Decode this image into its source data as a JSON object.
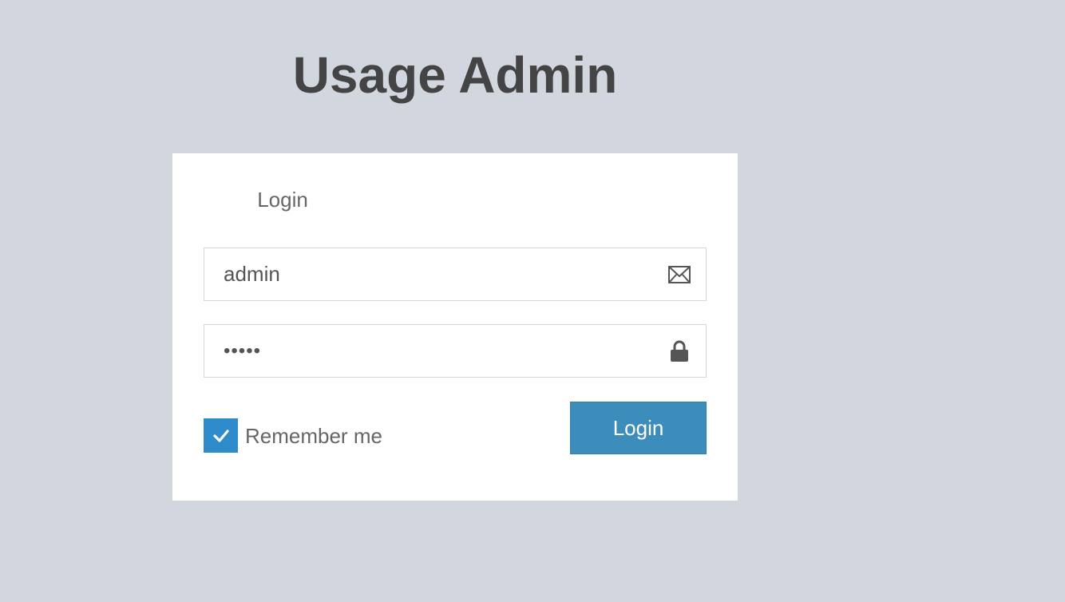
{
  "app": {
    "title": "Usage Admin"
  },
  "login": {
    "box_msg": "Login",
    "username": {
      "value": "admin",
      "icon": "envelope-icon"
    },
    "password": {
      "value": "admin",
      "icon": "lock-icon"
    },
    "remember": {
      "label": "Remember me",
      "checked": true
    },
    "submit_label": "Login"
  },
  "colors": {
    "page_background": "#d2d6df",
    "box_background": "#ffffff",
    "primary_button": "#3c8dbc",
    "checkbox_checked": "#2e8ccb",
    "title_text": "#444444"
  }
}
